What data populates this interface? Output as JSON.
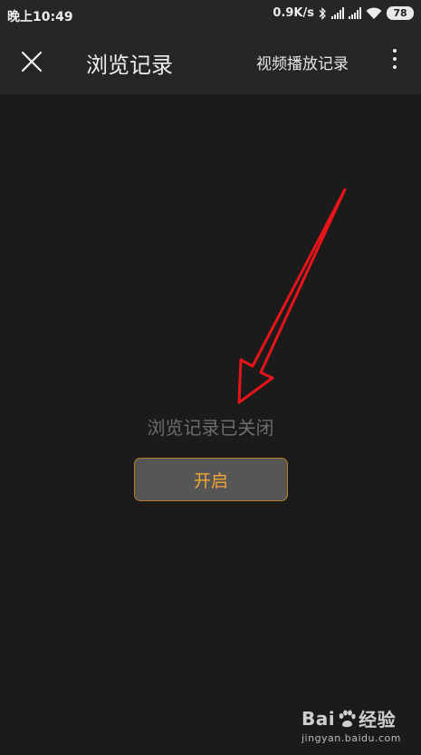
{
  "status_bar": {
    "time": "晚上10:49",
    "net_speed": "0.9K/s",
    "battery": "78",
    "icons": [
      "bluetooth-icon",
      "signal-icon",
      "signal-icon",
      "wifi-icon",
      "battery-icon"
    ]
  },
  "app_bar": {
    "close_icon": "close-icon",
    "title": "浏览记录",
    "history_link": "视频播放记录",
    "more_icon": "more-vertical-icon"
  },
  "main": {
    "empty_message": "浏览记录已关闭",
    "enable_button": "开启"
  },
  "annotation": {
    "arrow_color": "#e8141a"
  },
  "watermark": {
    "brand_left": "Bai",
    "brand_right": "经验",
    "url": "jingyan.baidu.com"
  },
  "colors": {
    "background": "#1b1b1b",
    "bar": "#262626",
    "button_bg": "#565656",
    "button_border": "#b57d27",
    "button_text": "#f2a735",
    "empty_text": "#6d6d6d"
  }
}
